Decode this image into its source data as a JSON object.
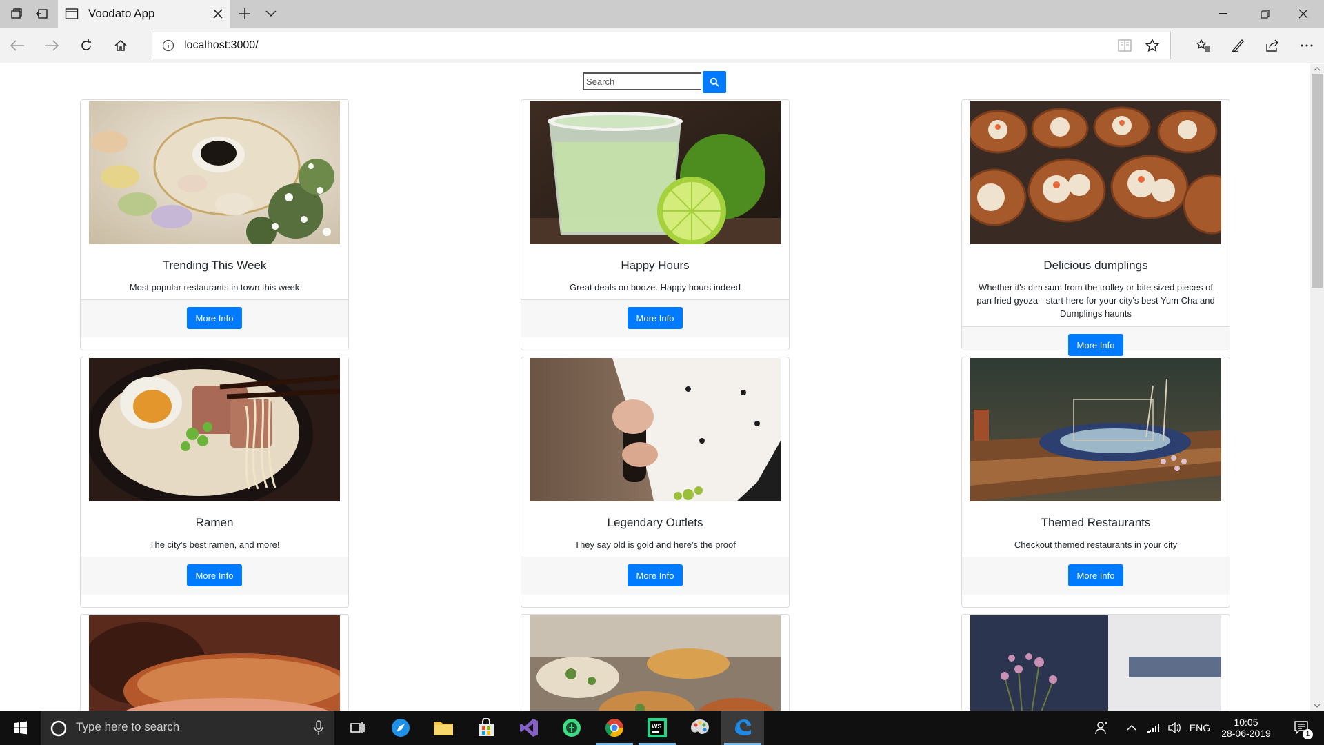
{
  "browser": {
    "tab_title": "Voodato App",
    "url": "localhost:3000/"
  },
  "search": {
    "placeholder": "Search"
  },
  "cards": [
    {
      "title": "Trending This Week",
      "text": "Most popular restaurants in town this week",
      "button": "More Info"
    },
    {
      "title": "Happy Hours",
      "text": "Great deals on booze. Happy hours indeed",
      "button": "More Info"
    },
    {
      "title": "Delicious dumplings",
      "text": "Whether it's dim sum from the trolley or bite sized pieces of pan fried gyoza - start here for your city's best Yum Cha and Dumplings haunts",
      "button": "More Info"
    },
    {
      "title": "Ramen",
      "text": "The city's best ramen, and more!",
      "button": "More Info"
    },
    {
      "title": "Legendary Outlets",
      "text": "They say old is gold and here's the proof",
      "button": "More Info"
    },
    {
      "title": "Themed Restaurants",
      "text": "Checkout themed restaurants in your city",
      "button": "More Info"
    }
  ],
  "taskbar": {
    "search_placeholder": "Type here to search",
    "language": "ENG",
    "time": "10:05",
    "date": "28-06-2019",
    "notification_count": "1"
  },
  "colors": {
    "accent": "#007bff",
    "card_footer": "#f7f7f7",
    "taskbar": "#101010"
  }
}
